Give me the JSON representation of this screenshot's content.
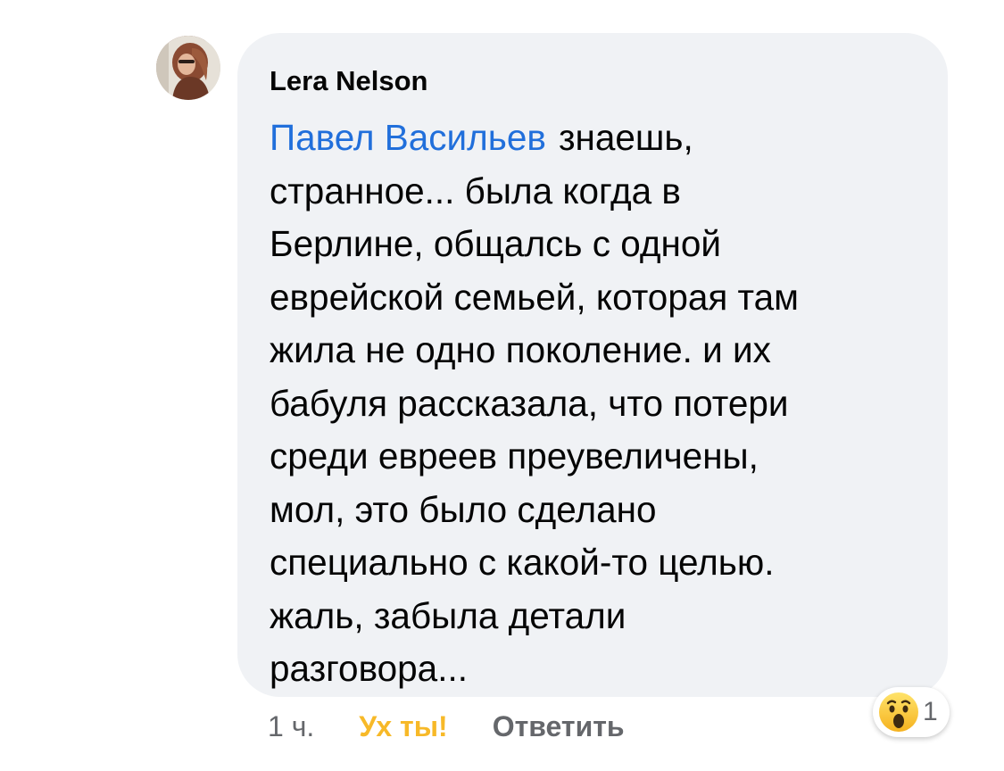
{
  "comment": {
    "author": "Lera Nelson",
    "avatar_icon": "profile-photo-avatar",
    "mention": "Павел Васильев",
    "lines": [
      "знаешь,",
      "странное... была когда в",
      "Берлине, общалсь с одной",
      "еврейской семьей, которая там",
      "жила не одно поколение. и их",
      "бабуля рассказала, что потери",
      "среди евреев преувеличены,",
      "мол, это было сделано",
      "специально с какой-то целью.",
      "жаль, забыла детали",
      "разговора..."
    ],
    "bubble_color": "#f0f2f5",
    "mention_color": "#216fdb"
  },
  "actions": {
    "time": "1 ч.",
    "reaction_label": "Ух ты!",
    "reaction_label_color": "#f7b928",
    "reply_label": "Ответить"
  },
  "reaction_summary": {
    "icon": "wow-emoji-icon",
    "count": "1"
  }
}
